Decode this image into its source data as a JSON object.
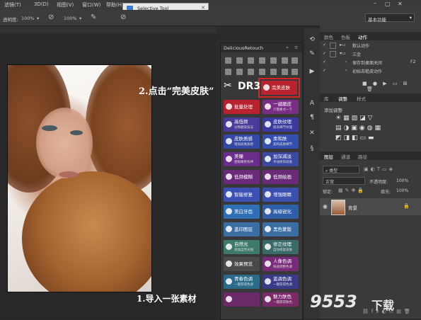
{
  "menubar": {
    "items": [
      "滤镜(T)",
      "3D(D)",
      "视图(V)",
      "窗口(W)",
      "帮助(H)"
    ]
  },
  "options_bar": {
    "opacity_label": "透明度:",
    "opacity_value": "100%",
    "flow_value": "100%",
    "workspace": "基本功能"
  },
  "selective_tool": {
    "title": "Selective Tool"
  },
  "dr3_panel": {
    "title": "DeliciousRetouch",
    "buttons": [
      {
        "l1": "批量处理",
        "l2": "",
        "color": "#b8232f"
      },
      {
        "l1": "一键磨皮",
        "l2": "只需要点一下",
        "color": "#7b2c86"
      },
      {
        "l1": "高低频",
        "l2": "分频磨皮技法",
        "color": "#4a3b9a"
      },
      {
        "l1": "皮肤纹理",
        "l2": "提高细节纹理",
        "color": "#3a3aa0"
      },
      {
        "l1": "皮肤质感",
        "l2": "增加皮肤质感",
        "color": "#3448a6"
      },
      {
        "l1": "柔和肤",
        "l2": "柔和皮肤细节",
        "color": "#354fb0"
      },
      {
        "l1": "美瞳",
        "l2": "使眼睛更有神",
        "color": "#6a2d8c"
      },
      {
        "l1": "加深减淡",
        "l2": "手动修饰皮肤",
        "color": "#3b49a3"
      },
      {
        "l1": "低频模糊",
        "l2": "",
        "color": "#6b2a7a"
      },
      {
        "l1": "低频绘画",
        "l2": "",
        "color": "#6b2a7a"
      },
      {
        "l1": "智能修复",
        "l2": "",
        "color": "#3b52b4"
      },
      {
        "l1": "增强眼睛",
        "l2": "",
        "color": "#3a4fae"
      },
      {
        "l1": "美白牙齿",
        "l2": "",
        "color": "#2f6fb5"
      },
      {
        "l1": "高级锐化",
        "l2": "",
        "color": "#2f5ea8"
      },
      {
        "l1": "盖印图层",
        "l2": "",
        "color": "#3a6ea3"
      },
      {
        "l1": "黑色蒙版",
        "l2": "",
        "color": "#3a6ea3"
      },
      {
        "l1": "自然光",
        "l2": "添加自然光线",
        "color": "#3e7a6c"
      },
      {
        "l1": "修正纹理",
        "l2": "自动修复皮肤",
        "color": "#3a6a6a"
      },
      {
        "l1": "效果预览",
        "l2": "",
        "color": "#4a4a4a"
      },
      {
        "l1": "人像色调",
        "l2": "快速调整色调",
        "color": "#7a2a7a"
      },
      {
        "l1": "青春色调",
        "l2": "一键获得色调",
        "color": "#2a6a8a"
      },
      {
        "l1": "蓝调色调",
        "l2": "一键获得色调",
        "color": "#3a3a8a"
      },
      {
        "l1": "",
        "l2": "",
        "color": "#6a2a6a"
      },
      {
        "l1": "魅力肤色",
        "l2": "一键获得肤色",
        "color": "#7a2a6a"
      }
    ],
    "highlight_button": {
      "l1": "完美皮肤",
      "color": "#b8232f"
    }
  },
  "right_panels": {
    "top_tabs": [
      "颜色",
      "色板",
      "动作"
    ],
    "actions": [
      {
        "label": "默认动作",
        "key": ""
      },
      {
        "label": "三金",
        "key": ""
      },
      {
        "label": "保存到桌面关闭",
        "key": "F2"
      },
      {
        "label": "初始去糙皮动作",
        "key": ""
      }
    ],
    "mid_tabs": [
      "库",
      "调整",
      "样式"
    ],
    "adjust_title": "添加调整",
    "layers_tabs": [
      "图层",
      "通道",
      "路径"
    ],
    "kind_label": "类型",
    "blend_mode": "正常",
    "opacity_label": "不透明度:",
    "opacity_value": "100%",
    "lock_label": "锁定:",
    "fill_label": "填充:",
    "fill_value": "100%",
    "layer_name": "背景"
  },
  "annotations": {
    "step2": "2.点击“完美皮肤”",
    "dr3_logo": "DR3",
    "step1": "1.导入一张素材",
    "watermark_num": "9553",
    "watermark_text": "下载"
  }
}
